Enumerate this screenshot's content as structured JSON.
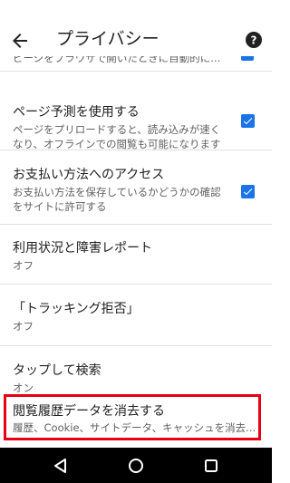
{
  "appbar": {
    "title": "プライバシー",
    "back_icon": "arrow-back-icon",
    "help_icon": "help-icon"
  },
  "partial_row": {
    "text": "ピージをブラウザで開いたときに自動的に..."
  },
  "settings": [
    {
      "title": "ページ予測を使用する",
      "subtitle": "ページをプリロードすると、読み込みが速く\nなり、オフラインでの閲覧も可能になります",
      "checked": true
    },
    {
      "title": "お支払い方法へのアクセス",
      "subtitle": "お支払い方法を保存しているかどうかの確認\nをサイトに許可する",
      "checked": true
    },
    {
      "title": "利用状況と障害レポート",
      "subtitle": "オフ"
    },
    {
      "title": "「トラッキング拒否」",
      "subtitle": "オフ"
    },
    {
      "title": "タップして検索",
      "subtitle": "オン"
    },
    {
      "title": "閲覧履歴データを消去する",
      "subtitle": "履歴、Cookie、サイトデータ、キャッシュを消去..."
    }
  ],
  "colors": {
    "accent": "#1a73e8",
    "highlight": "#e60012",
    "navbar": "#000000"
  },
  "navbar": {
    "back_icon": "nav-back-triangle-icon",
    "home_icon": "nav-home-circle-icon",
    "recents_icon": "nav-recents-square-icon"
  }
}
